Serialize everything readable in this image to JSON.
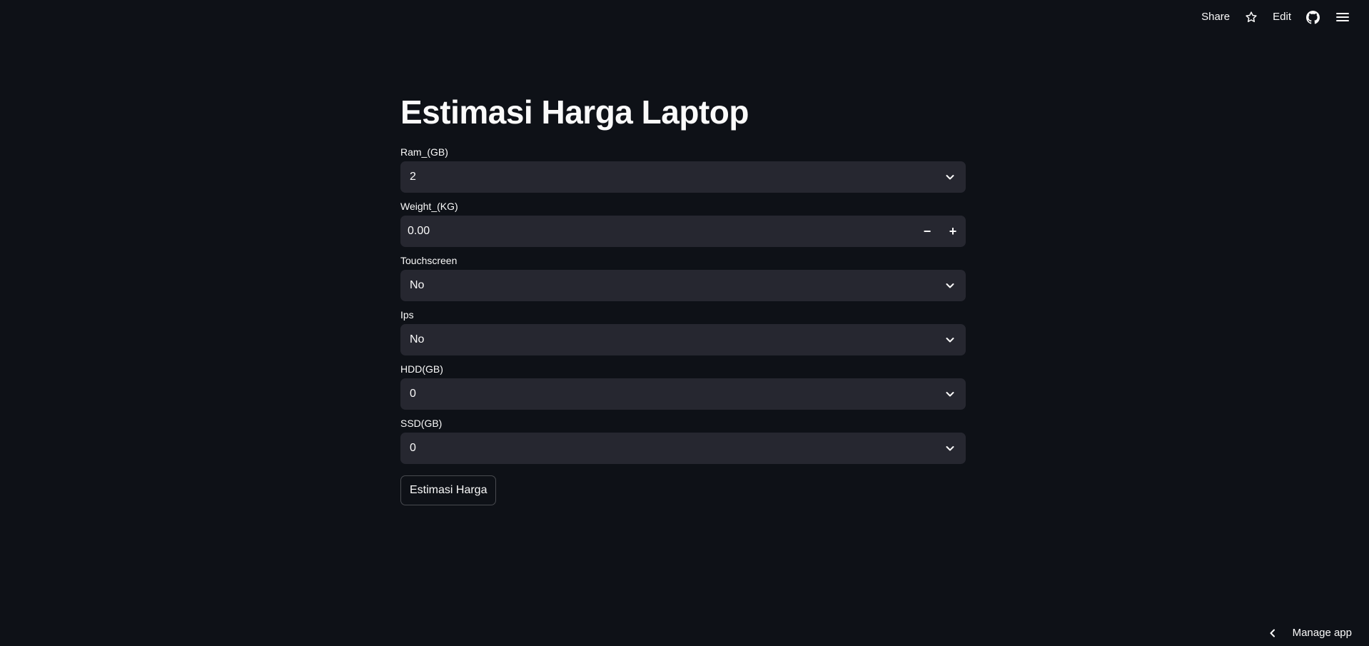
{
  "toolbar": {
    "share_label": "Share",
    "star_icon": "star-icon",
    "edit_label": "Edit",
    "github_icon": "github-icon",
    "menu_icon": "hamburger-menu-icon"
  },
  "page": {
    "title": "Estimasi Harga Laptop"
  },
  "fields": {
    "ram": {
      "label": "Ram_(GB)",
      "value": "2"
    },
    "weight": {
      "label": "Weight_(KG)",
      "value": "0.00",
      "minus": "−",
      "plus": "+"
    },
    "touchscreen": {
      "label": "Touchscreen",
      "value": "No"
    },
    "ips": {
      "label": "Ips",
      "value": "No"
    },
    "hdd": {
      "label": "HDD(GB)",
      "value": "0"
    },
    "ssd": {
      "label": "SSD(GB)",
      "value": "0"
    }
  },
  "actions": {
    "estimate_label": "Estimasi Harga"
  },
  "footer": {
    "manage_label": "Manage app"
  },
  "colors": {
    "background": "#0e1117",
    "input_bg": "#262730",
    "text": "#fafafa"
  }
}
